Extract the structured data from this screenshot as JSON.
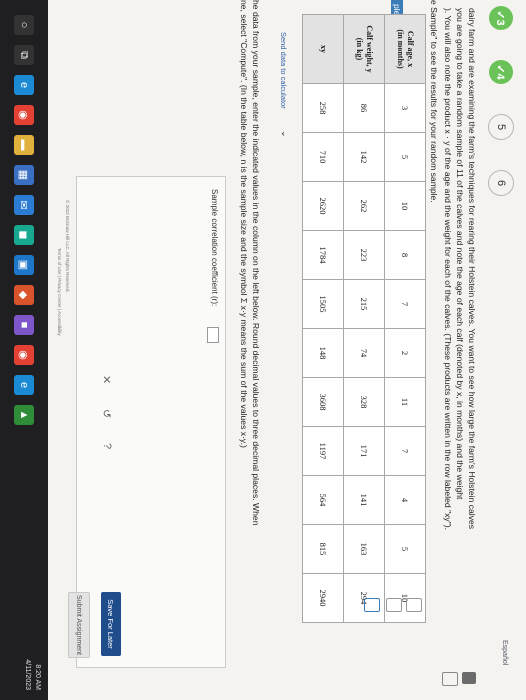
{
  "tabs": [
    {
      "label": "✓3",
      "state": "done"
    },
    {
      "label": "✓4",
      "state": "done"
    },
    {
      "label": "5",
      "state": "plain"
    },
    {
      "label": "6",
      "state": "plain"
    }
  ],
  "lang_link": "Español",
  "intro": {
    "line1": "dairy farm and are examining the farm's techniques for rearing their Holstein calves. You want to see how large the farm's Holstein calves",
    "line2": "you are going to take a random sample of 11 of the calves and note the age of each calf (denoted by x, in months) and the weight",
    "line3": "). You will also note the product x · y of the age and the weight for each of the calves. (These products are written in the row labeled \"xy\").",
    "line4": "e Sample\" to see the results for your random sample."
  },
  "side_label": "ple",
  "table": {
    "headers": [
      [
        "Calf age, x",
        "(in months)"
      ],
      [
        "Calf weight, y",
        "(in kg)"
      ],
      [
        "xy",
        ""
      ]
    ],
    "columns": [
      {
        "x": "3",
        "y": "86",
        "xy": "258"
      },
      {
        "x": "5",
        "y": "142",
        "xy": "710"
      },
      {
        "x": "10",
        "y": "262",
        "xy": "2620"
      },
      {
        "x": "8",
        "y": "223",
        "xy": "1784"
      },
      {
        "x": "7",
        "y": "215",
        "xy": "1505"
      },
      {
        "x": "2",
        "y": "74",
        "xy": "148"
      },
      {
        "x": "11",
        "y": "328",
        "xy": "3608"
      },
      {
        "x": "7",
        "y": "171",
        "xy": "1197"
      },
      {
        "x": "4",
        "y": "141",
        "xy": "564"
      },
      {
        "x": "5",
        "y": "163",
        "xy": "815"
      },
      {
        "x": "10",
        "y": "294",
        "xy": "2940"
      }
    ]
  },
  "send_data": "Send data to calculator",
  "instr": {
    "line1": "he data from your sample, enter the indicated values in the column on the left below. Round decimal values to three decimal places. When",
    "line2": "ne, select \"Compute\". (In the table below, n is the sample size and the symbol Σ x·y means the sum of the values x·y.)"
  },
  "answer": {
    "label": "Sample correlation coefficient (r):",
    "clear": "✕",
    "undo": "↺",
    "help": "?"
  },
  "buttons": {
    "save": "Save For Later",
    "submit": "Submit Assignment"
  },
  "footer": {
    "line1": "© 2023 McGraw Hill LLC. All Rights Reserved.",
    "line2": "Terms of Use  |  Privacy Center  |  Accessibility"
  },
  "tray": {
    "time": "8:20 AM",
    "date": "4/11/2023"
  },
  "taskbar_icons": [
    {
      "name": "search-icon",
      "glyph": "○",
      "color": "#333"
    },
    {
      "name": "taskview-icon",
      "glyph": "⧉",
      "color": "#333"
    },
    {
      "name": "edge-icon",
      "glyph": "e",
      "color": "#1a8ad4"
    },
    {
      "name": "chrome-icon",
      "glyph": "◉",
      "color": "#e34133"
    },
    {
      "name": "folder-icon",
      "glyph": "▬",
      "color": "#e0b13c"
    },
    {
      "name": "store-icon",
      "glyph": "▦",
      "color": "#3a6fc4"
    },
    {
      "name": "mail-icon",
      "glyph": "✉",
      "color": "#2b7cd3"
    },
    {
      "name": "app-icon",
      "glyph": "◼",
      "color": "#17a88f"
    },
    {
      "name": "photos-icon",
      "glyph": "▣",
      "color": "#1e76c9"
    },
    {
      "name": "office-icon",
      "glyph": "◆",
      "color": "#d9532c"
    },
    {
      "name": "app2-icon",
      "glyph": "■",
      "color": "#7d56c9"
    },
    {
      "name": "chrome2-icon",
      "glyph": "◉",
      "color": "#e34133"
    },
    {
      "name": "edge2-icon",
      "glyph": "e",
      "color": "#1a8ad4"
    },
    {
      "name": "app3-icon",
      "glyph": "▲",
      "color": "#2f8d3a"
    }
  ]
}
